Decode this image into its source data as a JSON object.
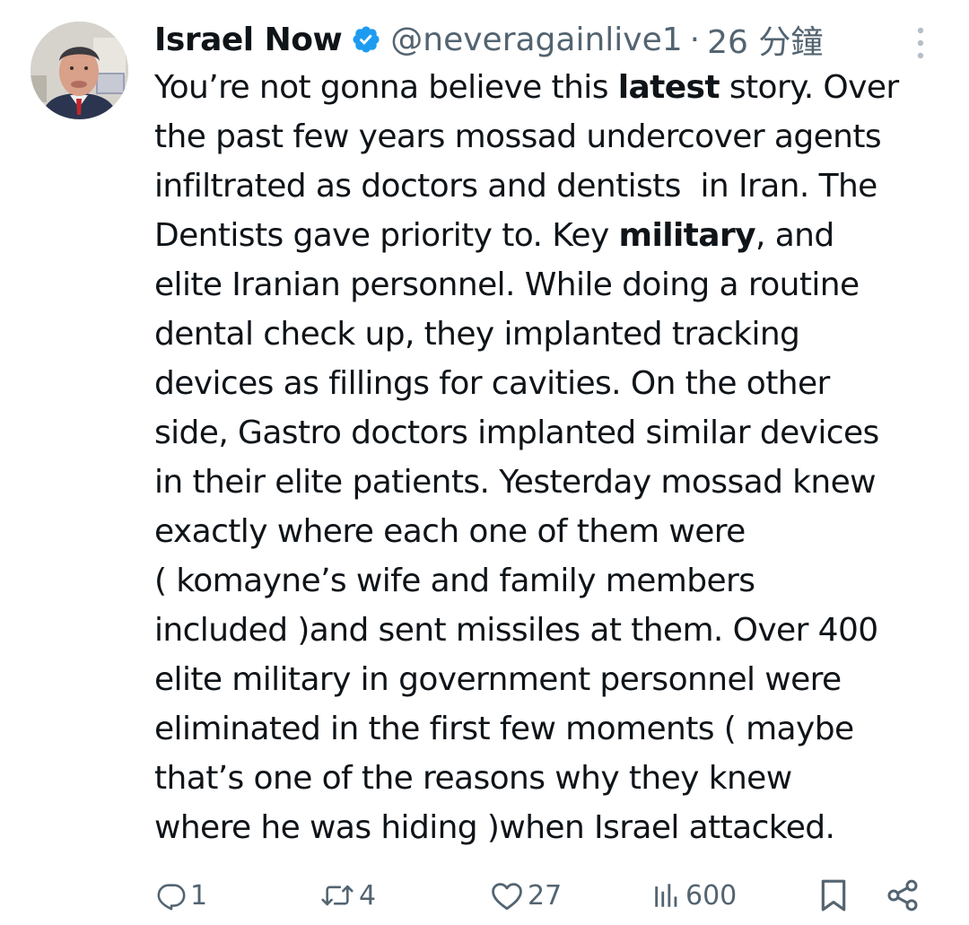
{
  "tweet": {
    "author": {
      "display_name": "Israel Now",
      "handle": "@neveragainlive1",
      "separator": "·",
      "time": "26 分鐘",
      "verified": true,
      "verified_color": "#1d9bf0"
    },
    "body_lines": [
      [
        {
          "t": "You’re not gonna believe this "
        },
        {
          "t": "latest",
          "b": true
        },
        {
          "t": " story. Over"
        }
      ],
      [
        {
          "t": "the past few years mossad undercover agents"
        }
      ],
      [
        {
          "t": "infiltrated as doctors and dentists  in Iran. The"
        }
      ],
      [
        {
          "t": "Dentists gave priority to. Key "
        },
        {
          "t": "military",
          "b": true
        },
        {
          "t": ", and"
        }
      ],
      [
        {
          "t": "elite Iranian personnel. While doing a routine"
        }
      ],
      [
        {
          "t": "dental check up, they implanted tracking"
        }
      ],
      [
        {
          "t": "devices as fillings for cavities. On the other"
        }
      ],
      [
        {
          "t": "side, Gastro doctors implanted similar devices"
        }
      ],
      [
        {
          "t": "in their elite patients. Yesterday mossad knew"
        }
      ],
      [
        {
          "t": "exactly where each one of them were"
        }
      ],
      [
        {
          "t": "( komayne’s wife and family members"
        }
      ],
      [
        {
          "t": "included )and sent missiles at them. Over 400"
        }
      ],
      [
        {
          "t": "elite military in government personnel were"
        }
      ],
      [
        {
          "t": "eliminated in the first few moments ( maybe"
        }
      ],
      [
        {
          "t": "that’s one of the reasons why they knew"
        }
      ],
      [
        {
          "t": "where he was hiding )when Israel attacked."
        }
      ]
    ],
    "actions": {
      "replies": "1",
      "reposts": "4",
      "likes": "27",
      "views": "600"
    },
    "icons": {
      "reply": "reply-icon",
      "repost": "repost-icon",
      "like": "heart-icon",
      "views": "views-icon",
      "bookmark": "bookmark-icon",
      "share": "share-icon",
      "more": "more-icon"
    },
    "colors": {
      "text": "#0f1419",
      "secondary": "#536471",
      "accent": "#1d9bf0"
    }
  }
}
